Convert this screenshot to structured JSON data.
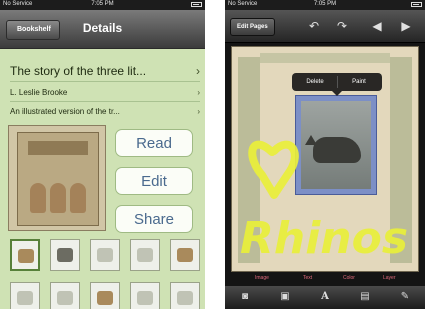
{
  "left_screen": {
    "status": {
      "carrier": "No Service",
      "time": "7:05 PM"
    },
    "nav": {
      "back_label": "Bookshelf",
      "title": "Details"
    },
    "book": {
      "title": "The story of the three lit...",
      "author": "L. Leslie Brooke",
      "description": "An illustrated version of the tr..."
    },
    "actions": {
      "read": "Read",
      "edit": "Edit",
      "share": "Share"
    },
    "chevron": "›"
  },
  "right_screen": {
    "status": {
      "carrier": "No Service",
      "time": "7:05 PM"
    },
    "toolbar": {
      "edit_pages": "Edit Pages"
    },
    "popup": {
      "delete": "Delete",
      "paint": "Paint"
    },
    "drawing_text": "Rhinos",
    "bottom_labels": [
      "Image",
      "Text",
      "Color",
      "Layer"
    ]
  },
  "colors": {
    "left_background": "#cfe2b4",
    "button_text": "#4a6a8e",
    "drawing_yellow": "#e9ef3a",
    "label_pink": "#e06a7c"
  },
  "icons": {
    "toolbar": [
      "undo-icon",
      "redo-icon",
      "previous-page-icon",
      "next-page-icon"
    ],
    "bottombar": [
      "camera-icon",
      "photo-library-icon",
      "text-icon",
      "image-layer-icon",
      "brush-icon"
    ]
  }
}
